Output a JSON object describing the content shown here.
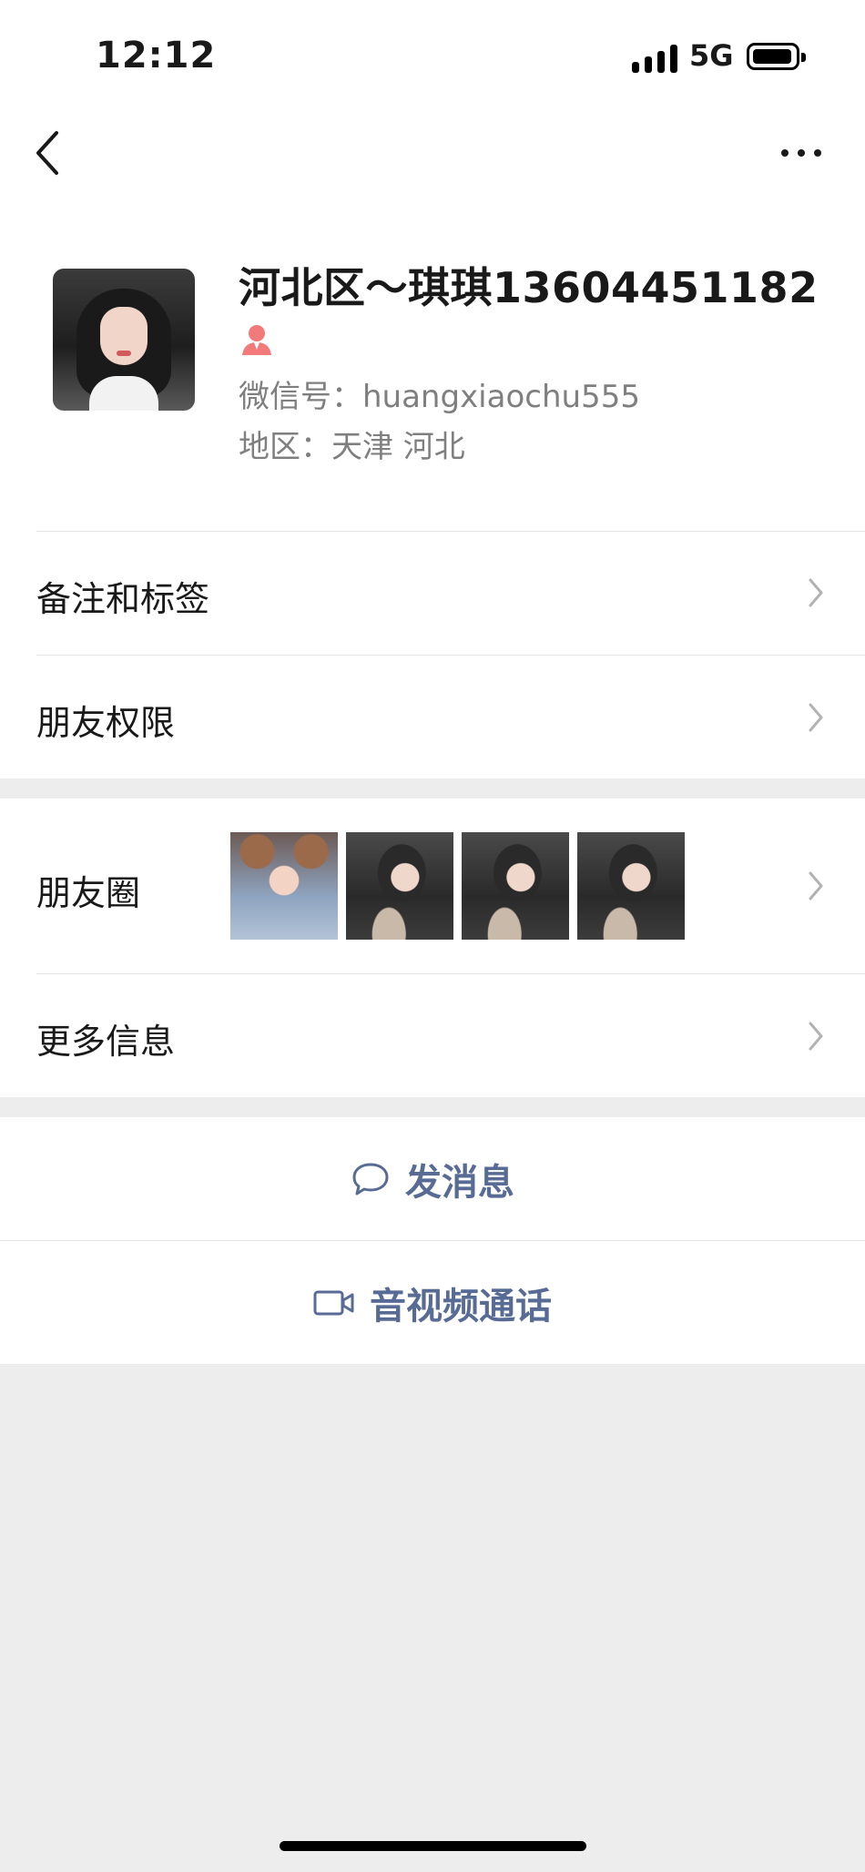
{
  "status_bar": {
    "time": "12:12",
    "network": "5G"
  },
  "nav": {
    "back_icon": "chevron-left-icon",
    "more_icon": "more-dots-icon"
  },
  "profile": {
    "name": "河北区～琪琪13604451182",
    "gender_icon": "female-icon",
    "wechat_id": "微信号：huangxiaochu555",
    "region": "地区：天津 河北"
  },
  "rows": {
    "remarks_tags": "备注和标签",
    "friend_permissions": "朋友权限",
    "moments": "朋友圈",
    "more_info": "更多信息"
  },
  "actions": {
    "send_message": "发消息",
    "av_call": "音视频通话"
  },
  "colors": {
    "link": "#576b95",
    "background": "#ededed",
    "female_icon": "#f27a7a"
  }
}
